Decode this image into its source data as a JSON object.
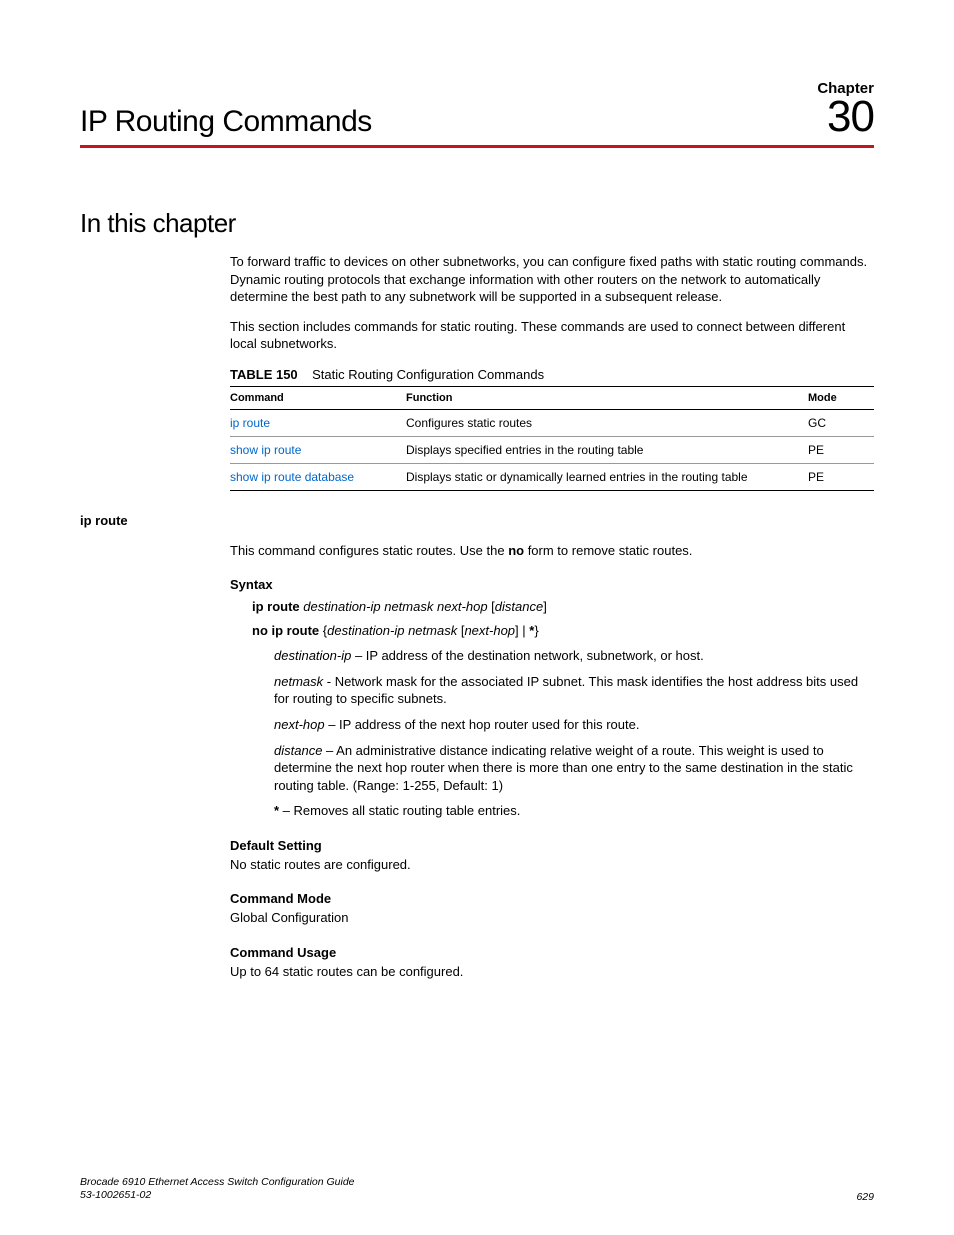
{
  "chapter": {
    "label": "Chapter",
    "number": "30",
    "title": "IP Routing Commands"
  },
  "section": {
    "title": "In this chapter",
    "para1": "To forward traffic to devices on other subnetworks, you can configure fixed paths with static routing commands. Dynamic routing protocols that exchange information with other routers on the network to automatically determine the best path to any subnetwork will be supported in a subsequent release.",
    "para2": "This section includes commands for static routing. These commands are used to connect between different local subnetworks."
  },
  "table": {
    "label": "TABLE 150",
    "caption": "Static Routing Configuration Commands",
    "headers": {
      "command": "Command",
      "function": "Function",
      "mode": "Mode"
    },
    "rows": [
      {
        "command": "ip route",
        "function": "Configures static routes",
        "mode": "GC"
      },
      {
        "command": "show ip route",
        "function": "Displays specified entries in the routing table",
        "mode": "PE"
      },
      {
        "command": "show ip route database",
        "function": "Displays static or dynamically learned entries in the routing table",
        "mode": "PE"
      }
    ]
  },
  "cmd": {
    "name": "ip route",
    "desc_pre": "This command configures static routes. Use the ",
    "desc_bold": "no",
    "desc_post": " form to remove static routes.",
    "syntax_label": "Syntax",
    "syntax1": {
      "bold": "ip route ",
      "italic": "destination-ip netmask next-hop",
      "after": " [",
      "italic2": "distance",
      "close": "]"
    },
    "syntax2": {
      "bold": "no ip route ",
      "brace_open": "{",
      "italic": "destination-ip netmask",
      "mid": " [",
      "italic2": "next-hop",
      "mid2": "] | ",
      "star": "*",
      "brace_close": "}"
    },
    "params": {
      "dest": {
        "name": "destination-ip",
        "desc": " – IP address of the destination network, subnetwork, or host."
      },
      "netmask": {
        "name": "netmask",
        "desc": " - Network mask for the associated IP subnet. This mask identifies the host address bits used for routing to specific subnets."
      },
      "nexthop": {
        "name": "next-hop",
        "desc": " – IP address of the next hop router used for this route."
      },
      "distance": {
        "name": "distance",
        "desc": " – An administrative distance indicating relative weight of a route. This weight is used to determine the next hop router when there is more than one entry to the same destination in the static routing table. (Range: 1-255, Default: 1)"
      },
      "star": {
        "name": "*",
        "desc": " – Removes all static routing table entries."
      }
    },
    "default_label": "Default Setting",
    "default_text": "No static routes are configured.",
    "mode_label": "Command Mode",
    "mode_text": "Global Configuration",
    "usage_label": "Command Usage",
    "usage_text": "Up to 64 static routes can be configured."
  },
  "footer": {
    "line1": "Brocade 6910 Ethernet Access Switch Configuration Guide",
    "line2": "53-1002651-02",
    "page": "629"
  }
}
